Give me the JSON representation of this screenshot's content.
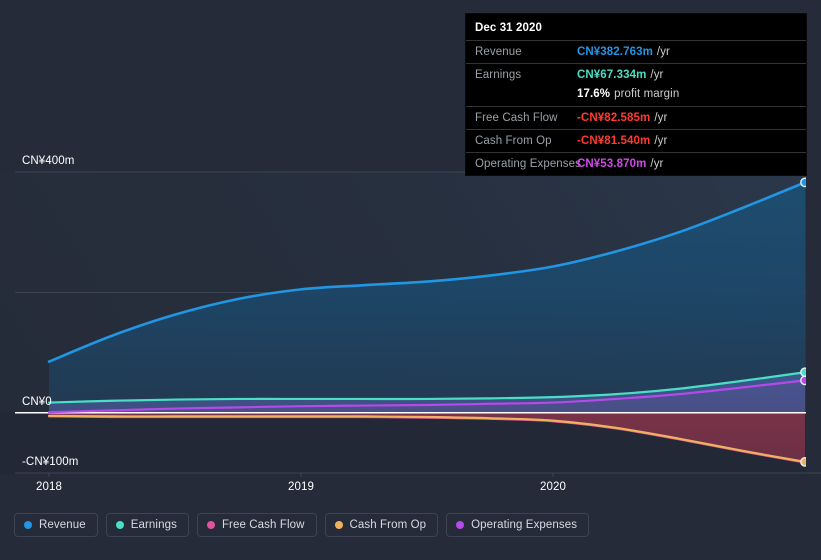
{
  "colors": {
    "background": "#252b38",
    "revenue": "#2196e3",
    "earnings": "#4adfc5",
    "free_cash_flow": "#e0529a",
    "cash_from_op": "#eeb25e",
    "operating_expenses": "#b44ae8",
    "zero_line": "#ffffff",
    "gridline": "#3d4453",
    "tooltip_bg": "#000000",
    "negative_value": "#ff3b30"
  },
  "tooltip": {
    "title": "Dec 31 2020",
    "rows": [
      {
        "label": "Revenue",
        "value": "CN¥382.763m",
        "unit": "/yr",
        "color": "#2196e3"
      },
      {
        "label": "Earnings",
        "value": "CN¥67.334m",
        "unit": "/yr",
        "color": "#4adfc5"
      },
      {
        "label": "",
        "value": "17.6%",
        "unit": "profit margin",
        "color": "#ffffff"
      },
      {
        "label": "Free Cash Flow",
        "value": "-CN¥82.585m",
        "unit": "/yr",
        "color": "#ff3b30"
      },
      {
        "label": "Cash From Op",
        "value": "-CN¥81.540m",
        "unit": "/yr",
        "color": "#ff3b30"
      },
      {
        "label": "Operating Expenses",
        "value": "CN¥53.870m",
        "unit": "/yr",
        "color": "#d14ae8"
      }
    ]
  },
  "legend": {
    "items": [
      {
        "label": "Revenue",
        "color": "#2196e3"
      },
      {
        "label": "Earnings",
        "color": "#4adfc5"
      },
      {
        "label": "Free Cash Flow",
        "color": "#e0529a"
      },
      {
        "label": "Cash From Op",
        "color": "#eeb25e"
      },
      {
        "label": "Operating Expenses",
        "color": "#b44ae8"
      }
    ]
  },
  "chart_data": {
    "type": "area",
    "title": "",
    "xlabel": "",
    "ylabel": "",
    "currency": "CN¥",
    "unit": "m",
    "grid": true,
    "legend_position": "bottom",
    "y_ticks": [
      {
        "label": "CN¥400m",
        "value": 400
      },
      {
        "label": "",
        "value": 200
      },
      {
        "label": "CN¥0",
        "value": 0
      },
      {
        "label": "-CN¥100m",
        "value": -100
      }
    ],
    "ylim": [
      -100,
      400
    ],
    "x_ticks": [
      {
        "label": "2018",
        "value": 2018.0
      },
      {
        "label": "2019",
        "value": 2019.0
      },
      {
        "label": "2020",
        "value": 2020.0
      }
    ],
    "xlim": [
      2018.0,
      2021.0
    ],
    "x": [
      2018.0,
      2018.25,
      2018.5,
      2018.75,
      2019.0,
      2019.25,
      2019.5,
      2019.75,
      2020.0,
      2020.25,
      2020.5,
      2020.75,
      2021.0
    ],
    "series": [
      {
        "name": "Revenue",
        "color": "#2196e3",
        "values": [
          85,
          128,
          163,
          189,
          205,
          212,
          218,
          228,
          243,
          268,
          300,
          340,
          382.763
        ],
        "end_value": 382.763,
        "end_label": "CN¥382.763m"
      },
      {
        "name": "Earnings",
        "color": "#4adfc5",
        "values": [
          17,
          20,
          22,
          23,
          23,
          23,
          23,
          24,
          26,
          31,
          40,
          53,
          67.334
        ],
        "end_value": 67.334,
        "end_label": "CN¥67.334m"
      },
      {
        "name": "Free Cash Flow",
        "color": "#e0529a",
        "values": [
          -6,
          -7,
          -7,
          -7,
          -7,
          -7,
          -8,
          -10,
          -14,
          -26,
          -44,
          -64,
          -82.585
        ],
        "end_value": -82.585,
        "end_label": "-CN¥82.585m"
      },
      {
        "name": "Cash From Op",
        "color": "#eeb25e",
        "values": [
          -5,
          -6,
          -6,
          -6,
          -6,
          -6,
          -7,
          -9,
          -13,
          -25,
          -43,
          -63,
          -81.54
        ],
        "end_value": -81.54,
        "end_label": "-CN¥81.540m"
      },
      {
        "name": "Operating Expenses",
        "color": "#b44ae8",
        "values": [
          1,
          4,
          7,
          9,
          11,
          12,
          13,
          15,
          17,
          23,
          31,
          42,
          53.87
        ],
        "end_value": 53.87,
        "end_label": "CN¥53.870m"
      }
    ]
  }
}
